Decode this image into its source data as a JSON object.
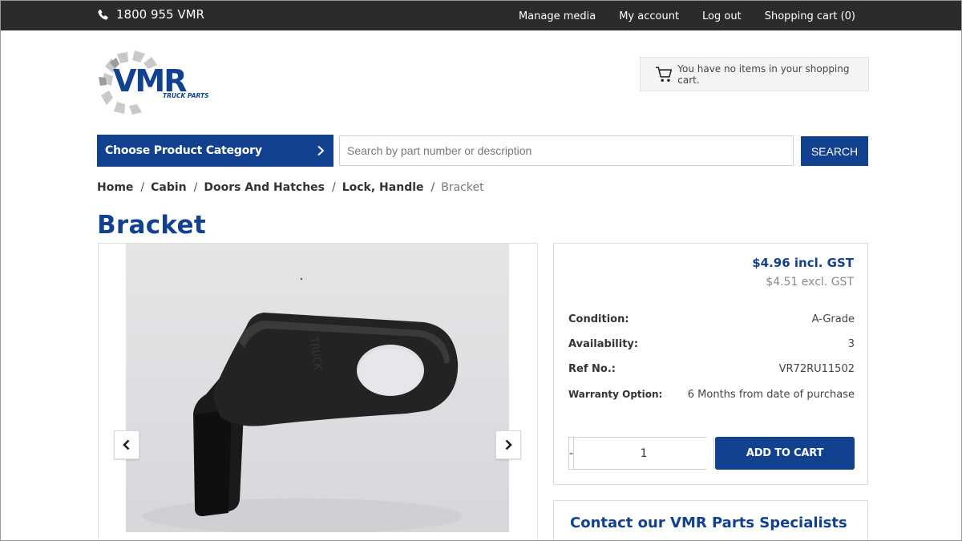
{
  "topbar": {
    "phone": "1800 955 VMR",
    "nav": [
      "Manage media",
      "My account",
      "Log out",
      "Shopping cart (0)"
    ]
  },
  "header": {
    "logo_text": "VMR",
    "logo_subtext": "TRUCK PARTS",
    "cart_summary": "You have no items in your shopping cart."
  },
  "search": {
    "category_label": "Choose Product Category",
    "placeholder": "Search by part number or description",
    "button_label": "SEARCH"
  },
  "breadcrumb": {
    "items": [
      "Home",
      "Cabin",
      "Doors And Hatches",
      "Lock, Handle"
    ],
    "current": "Bracket",
    "separator": "/"
  },
  "product": {
    "title": "Bracket",
    "price_incl": "$4.96 incl. GST",
    "price_excl": "$4.51 excl. GST",
    "specs": [
      {
        "label": "Condition:",
        "value": "A-Grade"
      },
      {
        "label": "Availability:",
        "value": "3"
      },
      {
        "label": "Ref No.:",
        "value": "VR72RU11502"
      },
      {
        "label": "Warranty Option:",
        "value": "6 Months from date of purchase"
      }
    ],
    "quantity": "1",
    "qty_minus": "-",
    "qty_plus": "+",
    "add_to_cart": "ADD TO CART"
  },
  "contact": {
    "title": "Contact our VMR Parts Specialists"
  },
  "colors": {
    "brand_blue": "#12418f",
    "topbar": "#2b2b2b"
  },
  "icons": {
    "phone": "phone-icon",
    "cart": "cart-icon",
    "chevron": "chevron-right-icon",
    "prev": "chevron-left-icon",
    "next": "chevron-right-icon"
  }
}
